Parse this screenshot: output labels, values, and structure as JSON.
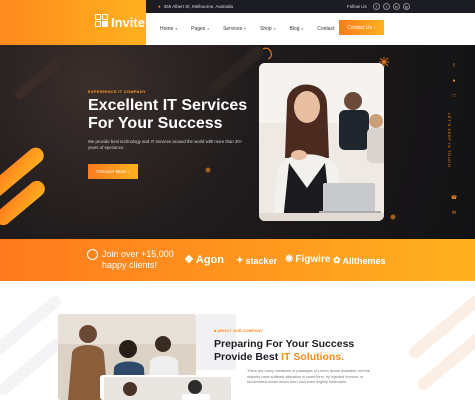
{
  "brand": {
    "name": "Invite"
  },
  "topbar": {
    "address": "350 Albert St, Melbourne, Australia",
    "follow_label": "Follow Us",
    "social": [
      "f",
      "t",
      "in",
      "ig"
    ]
  },
  "nav": {
    "items": [
      {
        "label": "Home",
        "has_dropdown": true
      },
      {
        "label": "Pages",
        "has_dropdown": true
      },
      {
        "label": "Services",
        "has_dropdown": true
      },
      {
        "label": "Shop",
        "has_dropdown": true
      },
      {
        "label": "Blog",
        "has_dropdown": true
      },
      {
        "label": "Contact",
        "has_dropdown": false
      }
    ],
    "cta": "Contact Us"
  },
  "hero": {
    "eyebrow": "EXPERIENCE IT COMPANY",
    "title": "Excellent IT Services For Your Success",
    "description": "We provide best technology and IT services around the world with more than 20+ years of eperiance.",
    "button": "Discover More",
    "side_label": "LET'S KEEP IN TOUCH"
  },
  "strip": {
    "join_line1": "Join over +15,000",
    "join_line2": "happy clients!",
    "brands": [
      "Agon",
      "stacker",
      "Figwire",
      "Allthemes"
    ]
  },
  "about": {
    "eyebrow": "ABOUT OUR COMPANY",
    "title_part1": "Preparing For Your Success Provide Best ",
    "title_highlight": "IT Solutions.",
    "description": "There are many variations of passages of Lorem Ipsum available, but the majority have suffered alteration in some form, by injected humour, or randomised words which don't look even slightly believable."
  },
  "colors": {
    "accent": "#ff8a1e",
    "accent2": "#ffb11f",
    "dark": "#1c1d24"
  }
}
